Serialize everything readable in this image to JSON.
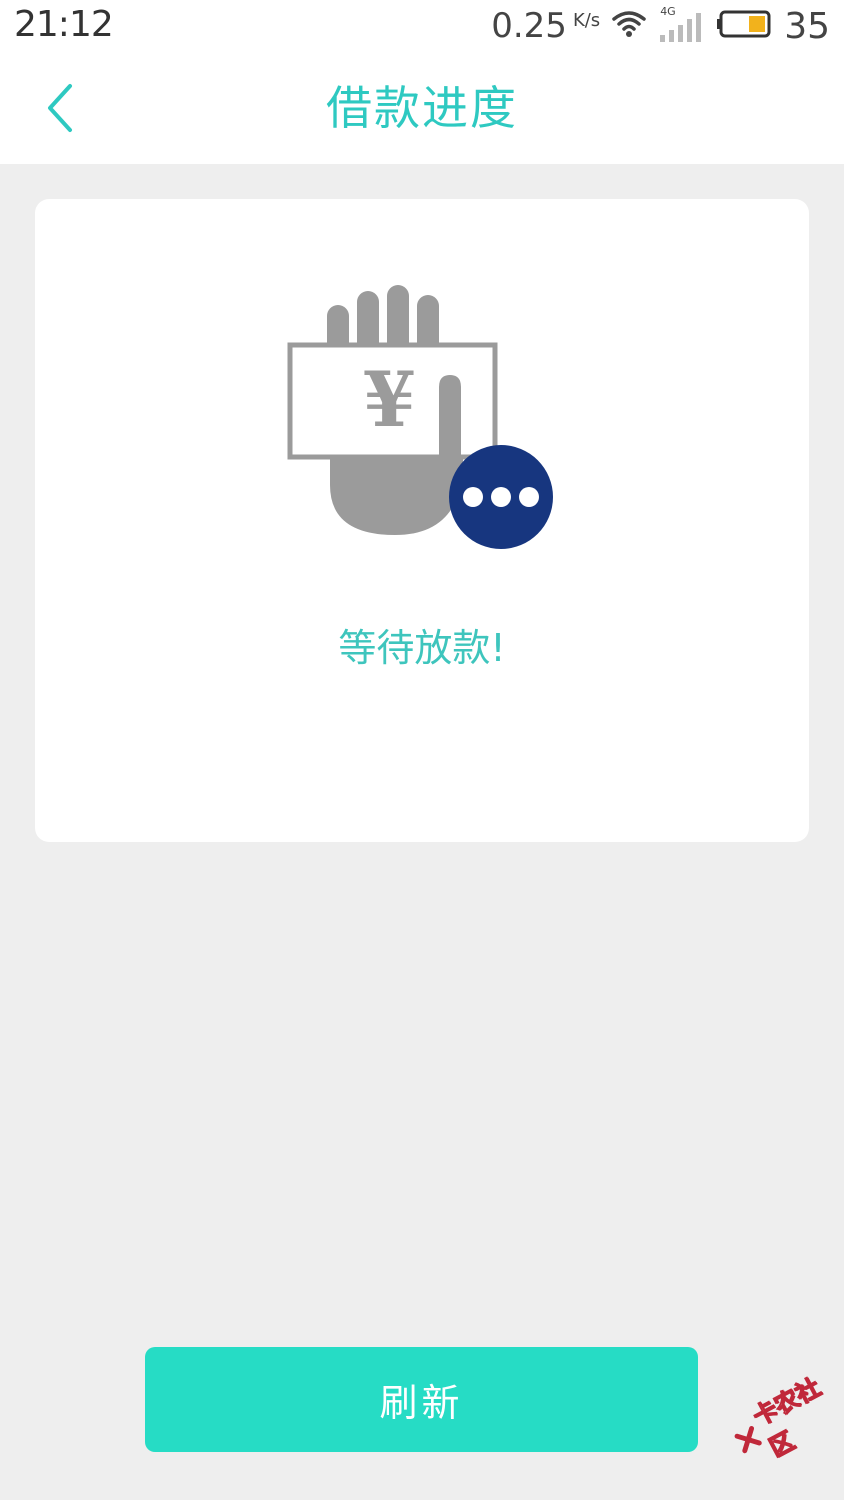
{
  "status_bar": {
    "time": "21:12",
    "net_speed": "0.25",
    "net_unit": "K/s",
    "signal_type": "4G",
    "battery_level": "35",
    "icons": [
      "wifi-icon",
      "signal-icon",
      "battery-icon"
    ]
  },
  "header": {
    "title": "借款进度",
    "back_icon": "chevron-left-icon"
  },
  "card": {
    "illustration_icon": "hand-money-pending-icon",
    "currency_symbol": "¥",
    "message": "等待放款!"
  },
  "footer": {
    "refresh_label": "刷新"
  },
  "watermark": {
    "text": "卡农社区"
  },
  "colors": {
    "accent": "#2ec9c1",
    "button": "#26dcc5",
    "badge": "#17367f",
    "icon_gray": "#9b9b9b",
    "background": "#eeeeee"
  }
}
